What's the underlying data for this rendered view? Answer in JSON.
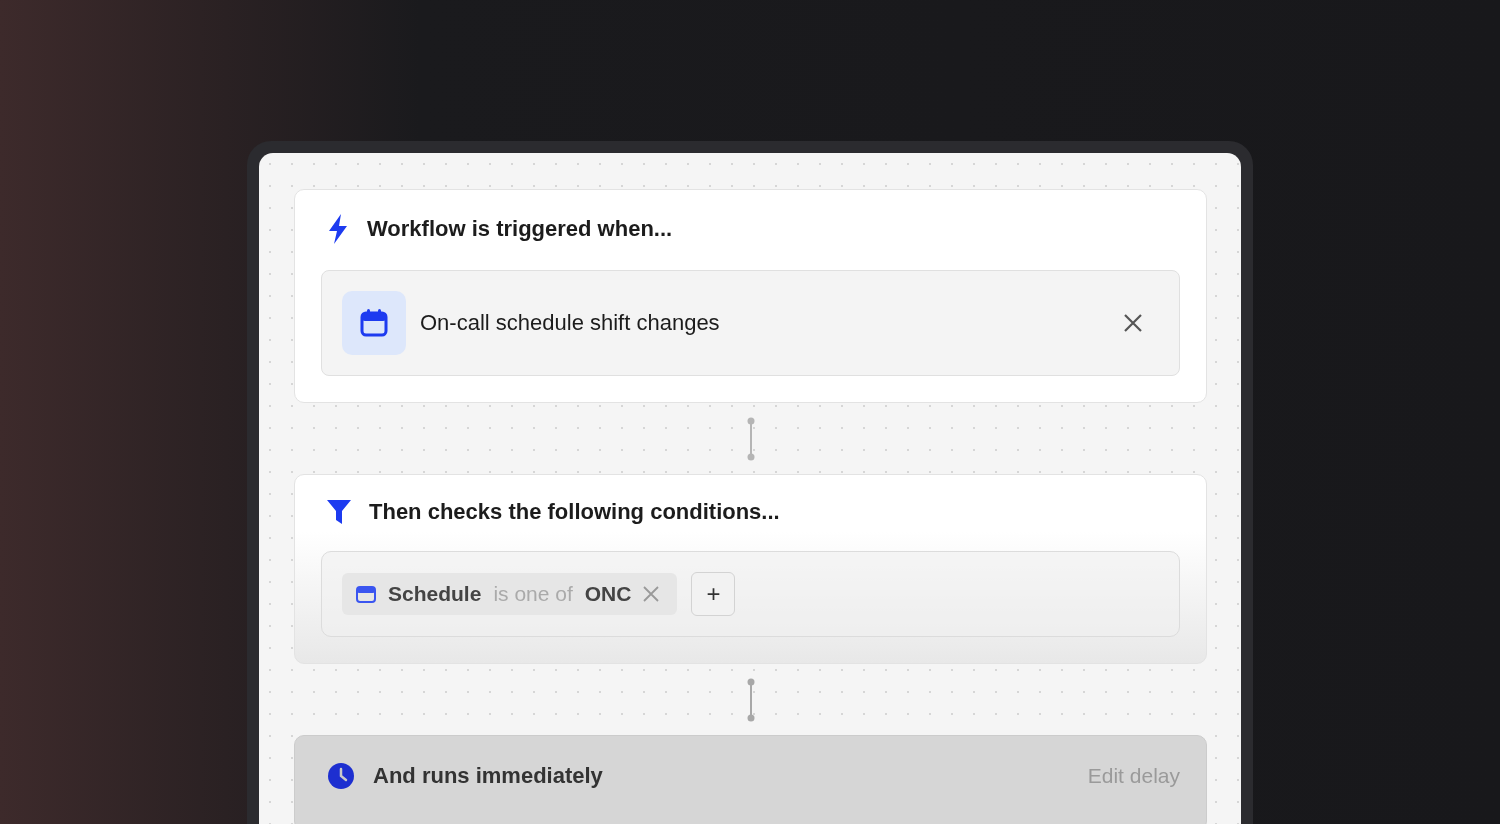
{
  "trigger": {
    "title": "Workflow is triggered when...",
    "item": "On-call schedule shift changes"
  },
  "conditions": {
    "title": "Then checks the following conditions...",
    "filters": [
      {
        "field": "Schedule",
        "operator": "is one of",
        "value": "ONC"
      }
    ],
    "add": "+"
  },
  "delay": {
    "title": "And runs immediately",
    "action": "Edit delay"
  }
}
